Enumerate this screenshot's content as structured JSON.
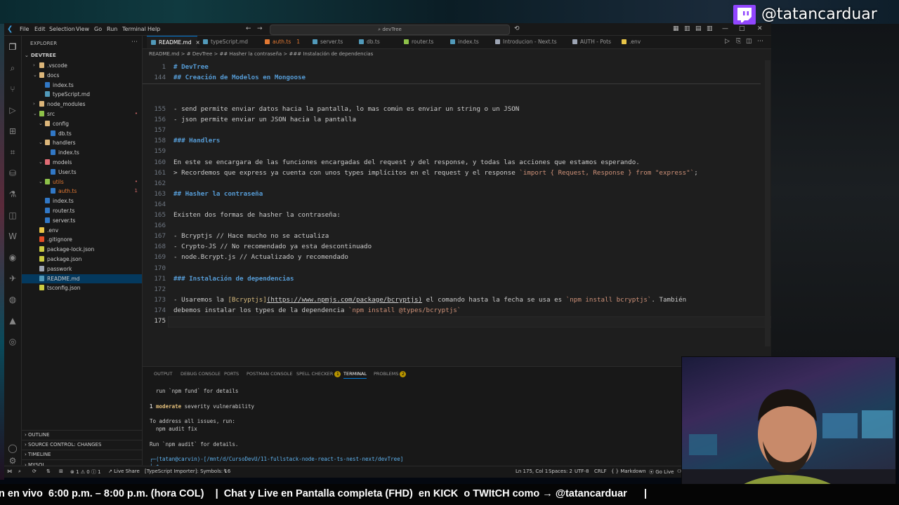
{
  "window": {
    "menu": [
      "File",
      "Edit",
      "Selection",
      "View",
      "Go",
      "Run",
      "Terminal",
      "Help"
    ],
    "search_text": "devTree"
  },
  "sidebar": {
    "title": "EXPLORER",
    "root": "DEVTREE",
    "items": [
      {
        "label": ".vscode",
        "kind": "folder",
        "depth": 1,
        "open": false
      },
      {
        "label": "docs",
        "kind": "folder",
        "depth": 1,
        "open": true
      },
      {
        "label": "index.ts",
        "kind": "ts",
        "depth": 2
      },
      {
        "label": "typeScript.md",
        "kind": "md",
        "depth": 2
      },
      {
        "label": "node_modules",
        "kind": "folder",
        "depth": 1,
        "open": false
      },
      {
        "label": "src",
        "kind": "folder-src",
        "depth": 1,
        "open": true,
        "status": "•"
      },
      {
        "label": "config",
        "kind": "folder",
        "depth": 2,
        "open": true
      },
      {
        "label": "db.ts",
        "kind": "ts",
        "depth": 3
      },
      {
        "label": "handlers",
        "kind": "folder",
        "depth": 2,
        "open": true
      },
      {
        "label": "index.ts",
        "kind": "ts",
        "depth": 3
      },
      {
        "label": "models",
        "kind": "folder-models",
        "depth": 2,
        "open": true
      },
      {
        "label": "User.ts",
        "kind": "ts",
        "depth": 3
      },
      {
        "label": "utils",
        "kind": "folder-utils",
        "depth": 2,
        "open": true,
        "status": "•"
      },
      {
        "label": "auth.ts",
        "kind": "ts-err",
        "depth": 3,
        "status": "1"
      },
      {
        "label": "index.ts",
        "kind": "ts",
        "depth": 2
      },
      {
        "label": "router.ts",
        "kind": "ts",
        "depth": 2
      },
      {
        "label": "server.ts",
        "kind": "ts",
        "depth": 2
      },
      {
        "label": ".env",
        "kind": "env",
        "depth": 1
      },
      {
        "label": ".gitignore",
        "kind": "git",
        "depth": 1
      },
      {
        "label": "package-lock.json",
        "kind": "json",
        "depth": 1
      },
      {
        "label": "package.json",
        "kind": "json",
        "depth": 1
      },
      {
        "label": "passwork",
        "kind": "file",
        "depth": 1
      },
      {
        "label": "README.md",
        "kind": "md",
        "depth": 1,
        "selected": true
      },
      {
        "label": "tsconfig.json",
        "kind": "json",
        "depth": 1
      }
    ],
    "sections": [
      "OUTLINE",
      "SOURCE CONTROL: CHANGES",
      "TIMELINE",
      "MYSQL"
    ]
  },
  "tabs": [
    {
      "label": "README.md",
      "active": true,
      "color": "#519aba",
      "close": "×"
    },
    {
      "label": "typeScript.md",
      "color": "#519aba"
    },
    {
      "label": "auth.ts",
      "color": "#e37933",
      "badge": "1",
      "error": true
    },
    {
      "label": "server.ts",
      "color": "#519aba"
    },
    {
      "label": "db.ts",
      "color": "#519aba"
    },
    {
      "label": "router.ts",
      "color": "#8dc149"
    },
    {
      "label": "index.ts",
      "color": "#519aba"
    },
    {
      "label": "Introducion - Next.ts",
      "color": "#9da5b4"
    },
    {
      "label": "AUTH - Pots",
      "color": "#9da5b4"
    },
    {
      "label": ".env",
      "color": "#e8c547"
    }
  ],
  "breadcrumb": "README.md > # DevTree > ## Hasher la contraseña > ### Instalación de dependencias",
  "editor": {
    "sticky": [
      {
        "n": "1",
        "text": "# DevTree"
      },
      {
        "n": "144",
        "text": "## Creación de Modelos en Mongoose"
      }
    ],
    "lines": [
      {
        "n": "155",
        "text": "- send permite enviar datos hacia la pantalla, lo mas común es enviar un string o un JSON"
      },
      {
        "n": "156",
        "text": "- json permite enviar un JSON hacia la pantalla"
      },
      {
        "n": "157",
        "text": ""
      },
      {
        "n": "158",
        "text": "### Handlers",
        "heading": true
      },
      {
        "n": "159",
        "text": ""
      },
      {
        "n": "160",
        "text": "En este se encargara de las funciones encargadas del request y del response, y todas las acciones que estamos esperando."
      },
      {
        "n": "161",
        "text": "> Recordemos que express ya cuenta con unos types implícitos en el request y el response ",
        "code": "`import { Request, Response } from \"express\"`",
        "tail": ";"
      },
      {
        "n": "162",
        "text": ""
      },
      {
        "n": "163",
        "text": "## Hasher la contraseña",
        "heading": true
      },
      {
        "n": "164",
        "text": ""
      },
      {
        "n": "165",
        "text": "Existen dos formas de hasher la contraseña:"
      },
      {
        "n": "166",
        "text": ""
      },
      {
        "n": "167",
        "text": "- Bcryptjs // Hace mucho no se actualiza"
      },
      {
        "n": "168",
        "text": "- Crypto-JS // No recomendado ya esta descontinuado"
      },
      {
        "n": "169",
        "text": "- node.Bcrypt.js // Actualizado y recomendado"
      },
      {
        "n": "170",
        "text": ""
      },
      {
        "n": "171",
        "text": "### Instalación de dependencias",
        "heading": true
      },
      {
        "n": "172",
        "text": ""
      },
      {
        "n": "173",
        "pre": "- Usaremos la ",
        "linktext": "[Bcryptjs]",
        "url": "(https://www.npmjs.com/package/bcryptjs)",
        "mid": " el comando hasta la fecha se usa es ",
        "code": "`npm install bcryptjs`",
        "tail": ". También"
      },
      {
        "n": "174",
        "text": "debemos instalar los types de la dependencia ",
        "code": "`npm install @types/bcryptjs`"
      },
      {
        "n": "175",
        "text": "",
        "current": true
      }
    ]
  },
  "panel": {
    "tabs": [
      {
        "label": "OUTPUT"
      },
      {
        "label": "DEBUG CONSOLE"
      },
      {
        "label": "PORTS"
      },
      {
        "label": "POSTMAN CONSOLE"
      },
      {
        "label": "SPELL CHECKER",
        "badge": "1"
      },
      {
        "label": "TERMINAL",
        "active": true
      },
      {
        "label": "PROBLEMS",
        "badge": "2"
      }
    ],
    "terminal": [
      "  run `npm fund` for details",
      "",
      "1 moderate severity vulnerability",
      "",
      "To address all issues, run:",
      "  npm audit fix",
      "",
      "Run `npm audit` for details.",
      "",
      "┌─(tatan@carvin)-[/mnt/d/CursoDevU/11-fullstack-node-react-ts-nest-next/devTree]",
      "└─$ "
    ]
  },
  "statusbar": {
    "problems": "⊗ 1 ⚠ 0 ⓘ 1",
    "live_share": "Live Share",
    "ts_status": "[TypeScript Importer]: Symbols: 16",
    "position": "Ln 175, Col 1",
    "spaces": "Spaces: 2",
    "encoding": "UTF-8",
    "eol": "CRLF",
    "language": "{ } Markdown",
    "go_live": "Go Live"
  },
  "overlay": {
    "twitch_handle": "@tatancarduar",
    "ticker": "n en vivo  6:00 p.m. – 8:00 p.m. (hora COL)    |  Chat y Live en Pantalla completa (FHD)  en KICK  o TWItCH como → @tatancarduar      |"
  },
  "colors": {
    "accent": "#0078d4",
    "heading": "#569cd6",
    "inline_code": "#ce9178",
    "twitch": "#9146ff"
  }
}
